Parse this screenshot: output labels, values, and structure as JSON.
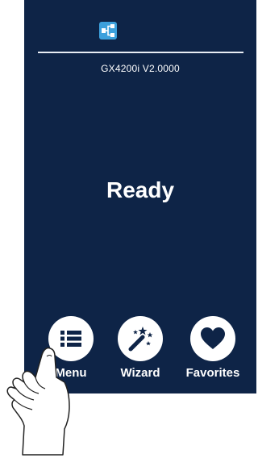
{
  "header": {
    "status_icon": "network-connection-icon",
    "model": "GX4200i V2.0000"
  },
  "main": {
    "status": "Ready"
  },
  "nav": {
    "menu": {
      "label": "Menu",
      "icon": "list-icon"
    },
    "wizard": {
      "label": "Wizard",
      "icon": "magic-wand-icon"
    },
    "favorites": {
      "label": "Favorites",
      "icon": "heart-icon"
    }
  },
  "colors": {
    "screen_bg": "#0e2447",
    "accent": "#3ca0dc",
    "button_bg": "#ffffff",
    "text": "#ffffff"
  }
}
